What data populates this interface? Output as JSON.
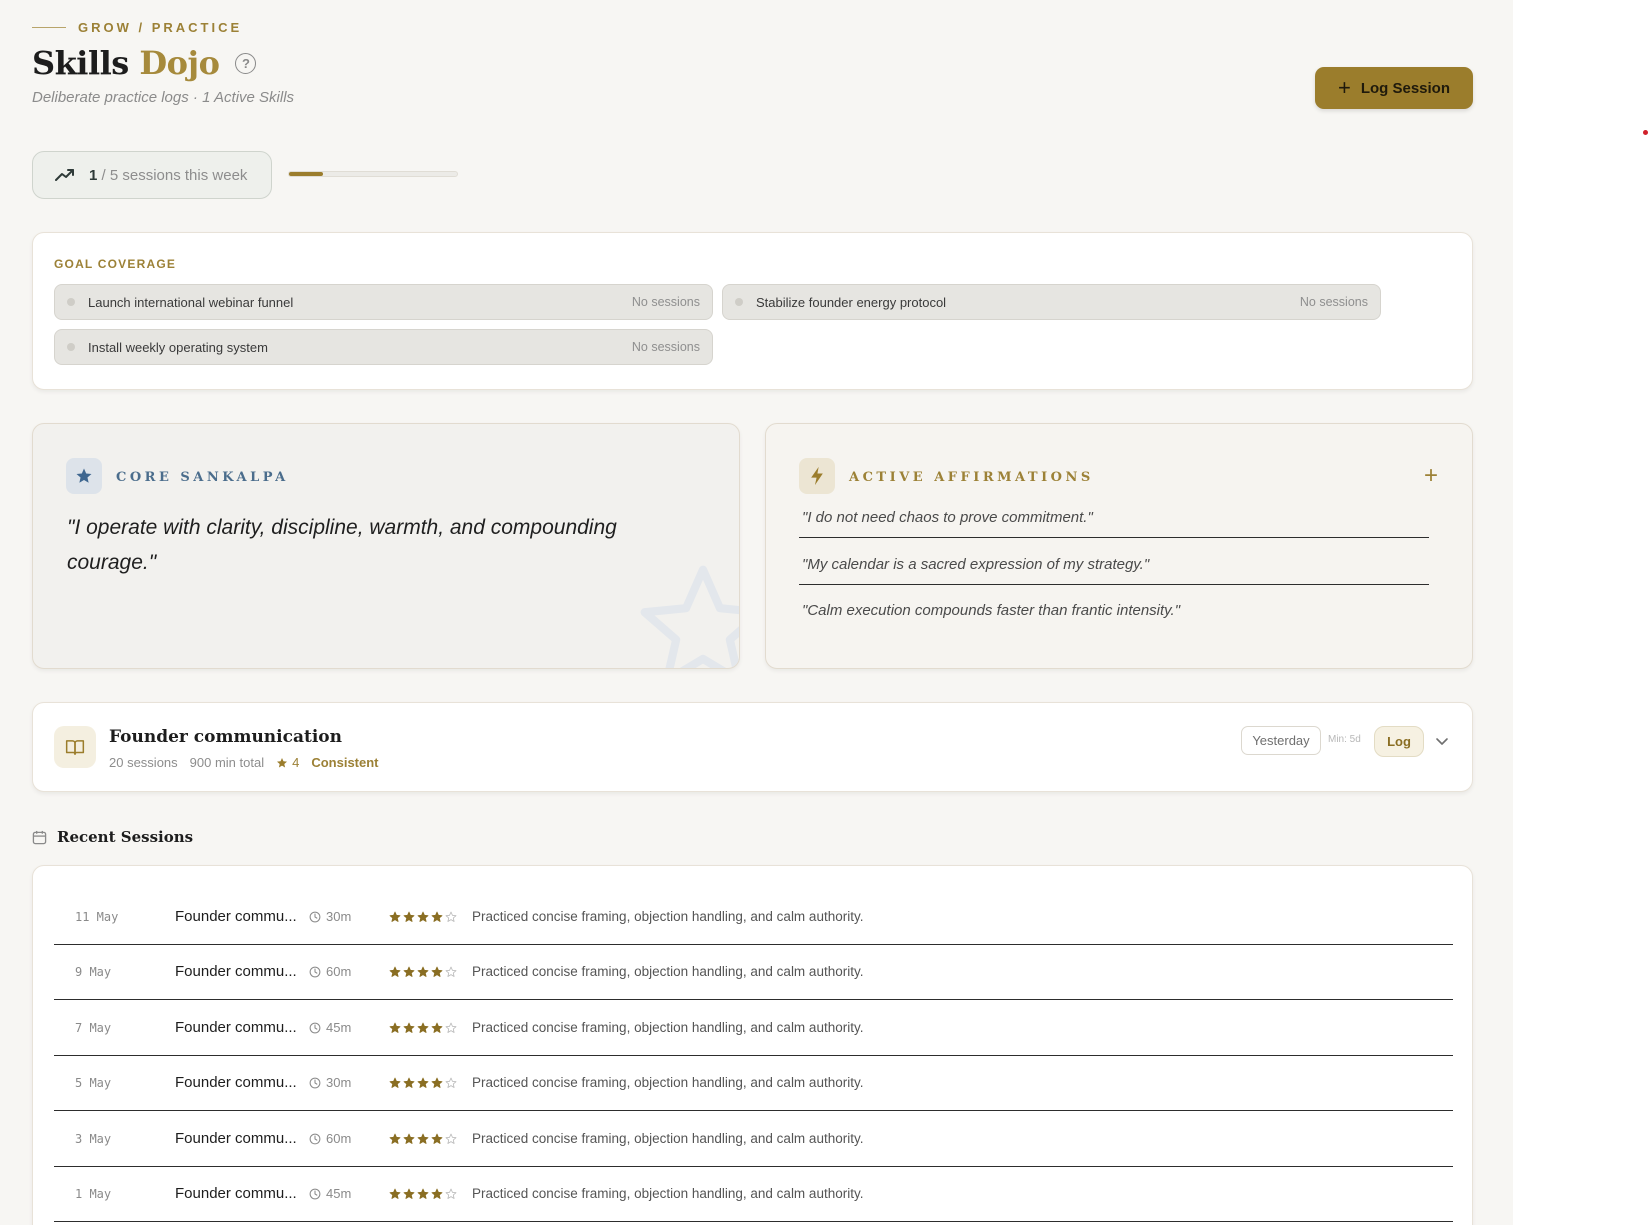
{
  "header": {
    "eyebrow": "GROW / PRACTICE",
    "title_main": "Skills",
    "title_accent": "Dojo",
    "subtitle": "Deliberate practice logs · 1 Active Skills",
    "log_button": "Log Session"
  },
  "week": {
    "done": "1",
    "rest": " / 5 sessions this week",
    "progress_fraction": 0.2
  },
  "goals": {
    "heading": "GOAL COVERAGE",
    "items": [
      {
        "label": "Launch international webinar funnel",
        "status": "No sessions"
      },
      {
        "label": "Stabilize founder energy protocol",
        "status": "No sessions"
      },
      {
        "label": "Install weekly operating system",
        "status": "No sessions"
      }
    ]
  },
  "sankalpa": {
    "label": "CORE SANKALPA",
    "text": "\"I operate with clarity, discipline, warmth, and compounding courage.\""
  },
  "affirmations": {
    "label": "ACTIVE AFFIRMATIONS",
    "add": "+",
    "items": [
      "\"I do not need chaos to prove commitment.\"",
      "\"My calendar is a sacred expression of my strategy.\"",
      "\"Calm execution compounds faster than frantic intensity.\""
    ]
  },
  "skill": {
    "name": "Founder communication",
    "sessions": "20 sessions",
    "minutes": "900 min total",
    "rating": "4",
    "consistency": "Consistent",
    "last": "Yesterday",
    "min_label": "Min: 5d",
    "log": "Log"
  },
  "recent": {
    "heading": "Recent Sessions",
    "rows": [
      {
        "date": "11 May",
        "name": "Founder commu...",
        "duration": "30m",
        "stars": 4,
        "note": "Practiced concise framing, objection handling, and calm authority."
      },
      {
        "date": "9 May",
        "name": "Founder commu...",
        "duration": "60m",
        "stars": 4,
        "note": "Practiced concise framing, objection handling, and calm authority."
      },
      {
        "date": "7 May",
        "name": "Founder commu...",
        "duration": "45m",
        "stars": 4,
        "note": "Practiced concise framing, objection handling, and calm authority."
      },
      {
        "date": "5 May",
        "name": "Founder commu...",
        "duration": "30m",
        "stars": 4,
        "note": "Practiced concise framing, objection handling, and calm authority."
      },
      {
        "date": "3 May",
        "name": "Founder commu...",
        "duration": "60m",
        "stars": 4,
        "note": "Practiced concise framing, objection handling, and calm authority."
      },
      {
        "date": "1 May",
        "name": "Founder commu...",
        "duration": "45m",
        "stars": 4,
        "note": "Practiced concise framing, objection handling, and calm authority."
      }
    ]
  },
  "colors": {
    "accent": "#9b7d2c",
    "background": "#f7f6f3",
    "sankalpa_blue": "#4b6d8c"
  }
}
